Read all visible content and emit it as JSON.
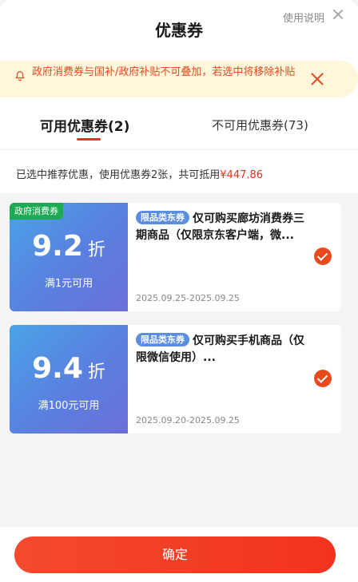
{
  "header": {
    "title": "优惠券",
    "help_link": "使用说明"
  },
  "notice": {
    "text": "政府消费券与国补/政府补贴不可叠加，若选中将移除补贴"
  },
  "tabs": {
    "available": "可用优惠券(2)",
    "unavailable": "不可用优惠券(73)"
  },
  "summary": {
    "text": "已选中推荐优惠，使用优惠券2张，共可抵用",
    "amount": "¥447.86"
  },
  "coupons": [
    {
      "badge": "政府消费券",
      "discount": "9.2",
      "discount_unit": "折",
      "condition": "满1元可用",
      "tag": "限品类东券",
      "description": "仅可购买廊坊消费券三期商品（仅限京东客户端，微...",
      "date": "2025.09.25-2025.09.25",
      "selected": true
    },
    {
      "badge": "",
      "discount": "9.4",
      "discount_unit": "折",
      "condition": "满100元可用",
      "tag": "限品类东券",
      "description": "仅可购买手机商品（仅限微信使用）...",
      "date": "2025.09.20-2025.09.25",
      "selected": true
    }
  ],
  "footer": {
    "confirm_label": "确定"
  },
  "colors": {
    "accent": "#e4321e",
    "coupon_blue": "#5a7fe0",
    "badge_green": "#1eaa55",
    "notice_bg": "#fff6dc"
  }
}
